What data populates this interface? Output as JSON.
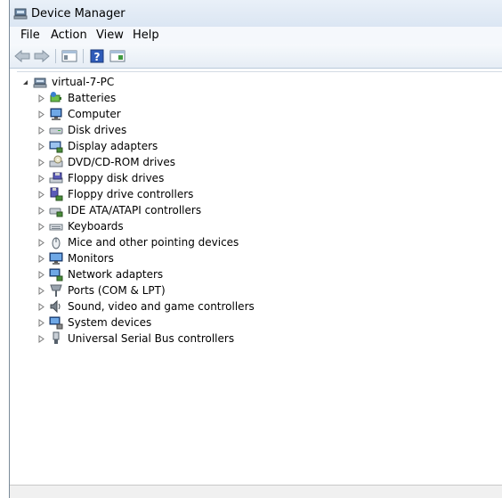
{
  "window": {
    "title": "Device Manager"
  },
  "menu": [
    "File",
    "Action",
    "View",
    "Help"
  ],
  "tree": {
    "root": "virtual-7-PC",
    "items": [
      {
        "label": "Batteries",
        "icon": "battery-icon"
      },
      {
        "label": "Computer",
        "icon": "computer-icon"
      },
      {
        "label": "Disk drives",
        "icon": "disk-drive-icon"
      },
      {
        "label": "Display adapters",
        "icon": "display-adapter-icon"
      },
      {
        "label": "DVD/CD-ROM drives",
        "icon": "dvd-drive-icon"
      },
      {
        "label": "Floppy disk drives",
        "icon": "floppy-disk-icon"
      },
      {
        "label": "Floppy drive controllers",
        "icon": "floppy-controller-icon"
      },
      {
        "label": "IDE ATA/ATAPI controllers",
        "icon": "ide-controller-icon"
      },
      {
        "label": "Keyboards",
        "icon": "keyboard-icon"
      },
      {
        "label": "Mice and other pointing devices",
        "icon": "mouse-icon"
      },
      {
        "label": "Monitors",
        "icon": "monitor-icon"
      },
      {
        "label": "Network adapters",
        "icon": "network-adapter-icon"
      },
      {
        "label": "Ports (COM & LPT)",
        "icon": "port-icon"
      },
      {
        "label": "Sound, video and game controllers",
        "icon": "sound-icon"
      },
      {
        "label": "System devices",
        "icon": "system-device-icon"
      },
      {
        "label": "Universal Serial Bus controllers",
        "icon": "usb-icon"
      }
    ]
  }
}
